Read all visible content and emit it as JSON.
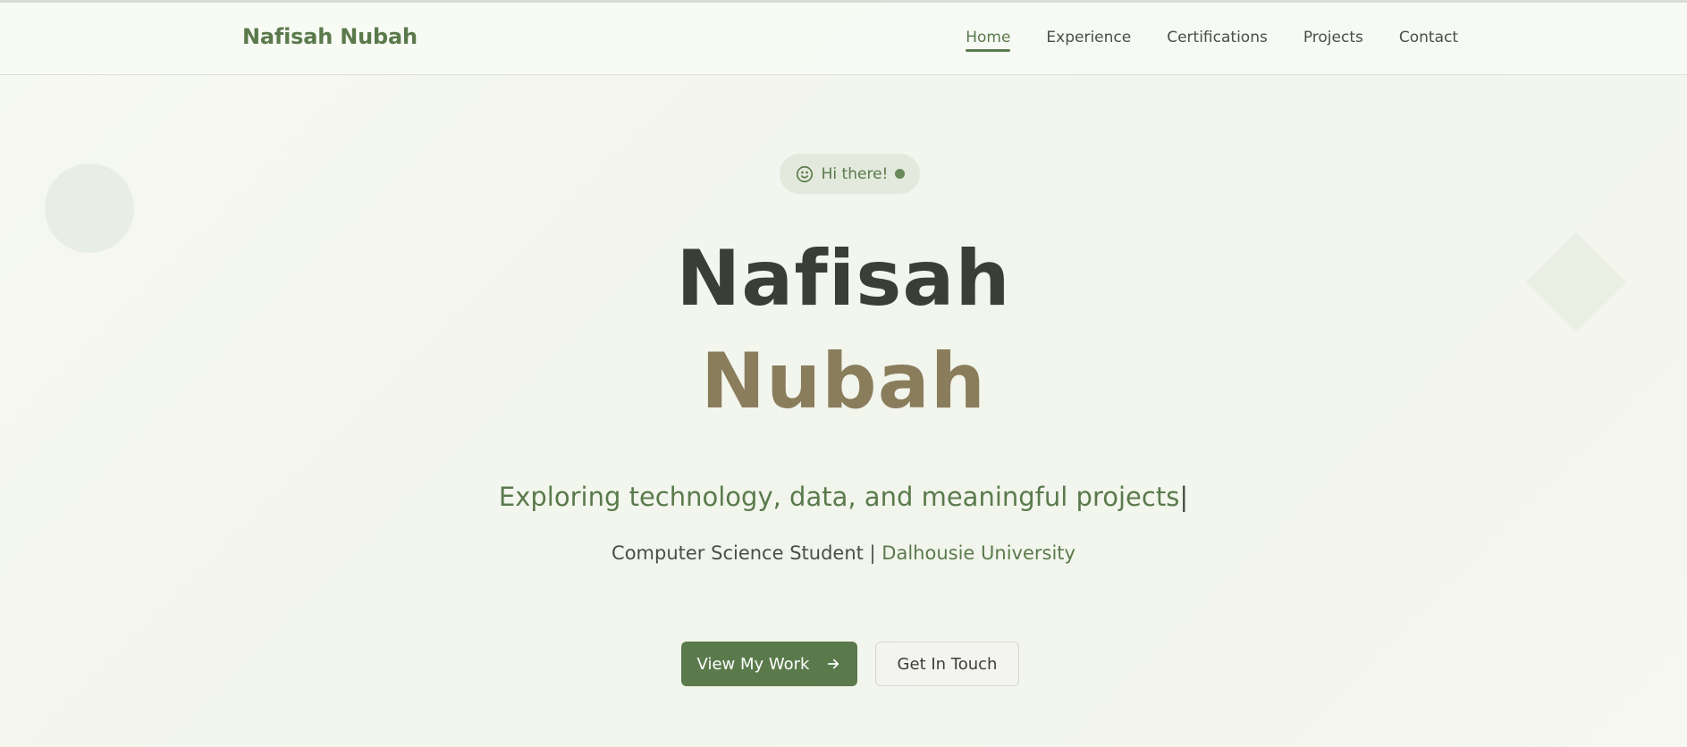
{
  "nav": {
    "brand": "Nafisah Nubah",
    "links": [
      {
        "label": "Home"
      },
      {
        "label": "Experience"
      },
      {
        "label": "Certifications"
      },
      {
        "label": "Projects"
      },
      {
        "label": "Contact"
      }
    ],
    "active_link": "Home"
  },
  "hero": {
    "greeting": "Hi there!",
    "greeting_icon": "smile-icon",
    "first_name": "Nafisah",
    "last_name": "Nubah",
    "tagline": "Exploring technology, data, and meaningful projects",
    "tagline_cursor": "|",
    "role": "Computer Science Student | ",
    "university": "Dalhousie University",
    "primary_button": "View My Work",
    "primary_button_icon": "arrow-right-icon",
    "secondary_button": "Get In Touch"
  },
  "colors": {
    "accent_green": "#5a7a4c",
    "dark_text": "#3a3f35",
    "gold_name": "#8a7d5c",
    "background": "#f4f7ef"
  }
}
